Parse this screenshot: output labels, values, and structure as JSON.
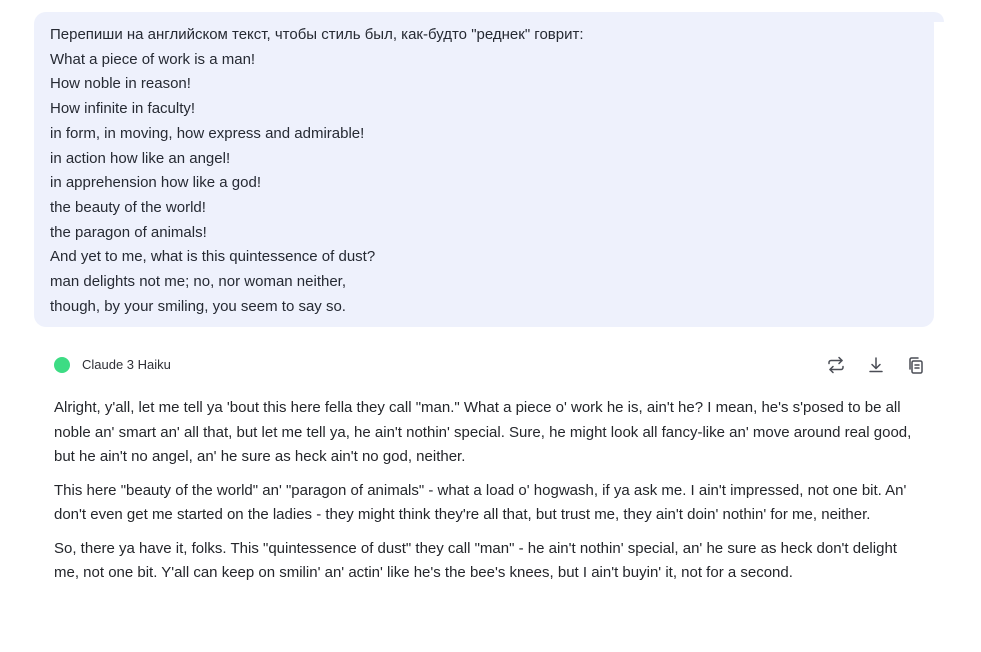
{
  "user_message": {
    "lines": [
      "Перепиши на английском текст, чтобы стиль был, как-будто \"реднек\" говрит:",
      "What a piece of work is a man!",
      "How noble in reason!",
      "How infinite in faculty!",
      "in form, in moving, how express and admirable!",
      "in action how like an angel!",
      "in apprehension how like a god!",
      "the beauty of the world!",
      "the paragon of animals!",
      "And yet to me, what is this quintessence of dust?",
      "man delights not me; no, nor woman neither,",
      "though, by your smiling, you seem to say so."
    ]
  },
  "bot": {
    "model_name": "Claude 3 Haiku",
    "status_color": "#3ddc84",
    "actions": {
      "regenerate_icon": "regenerate-icon",
      "download_icon": "download-icon",
      "copy_icon": "copy-icon"
    },
    "paragraphs": [
      "Alright, y'all, let me tell ya 'bout this here fella they call \"man.\" What a piece o' work he is, ain't he? I mean, he's s'posed to be all noble an' smart an' all that, but let me tell ya, he ain't nothin' special. Sure, he might look all fancy-like an' move around real good, but he ain't no angel, an' he sure as heck ain't no god, neither.",
      "This here \"beauty of the world\" an' \"paragon of animals\" - what a load o' hogwash, if ya ask me. I ain't impressed, not one bit. An' don't even get me started on the ladies - they might think they're all that, but trust me, they ain't doin' nothin' for me, neither.",
      "So, there ya have it, folks. This \"quintessence of dust\" they call \"man\" - he ain't nothin' special, an' he sure as heck don't delight me, not one bit. Y'all can keep on smilin' an' actin' like he's the bee's knees, but I ain't buyin' it, not for a second."
    ]
  }
}
